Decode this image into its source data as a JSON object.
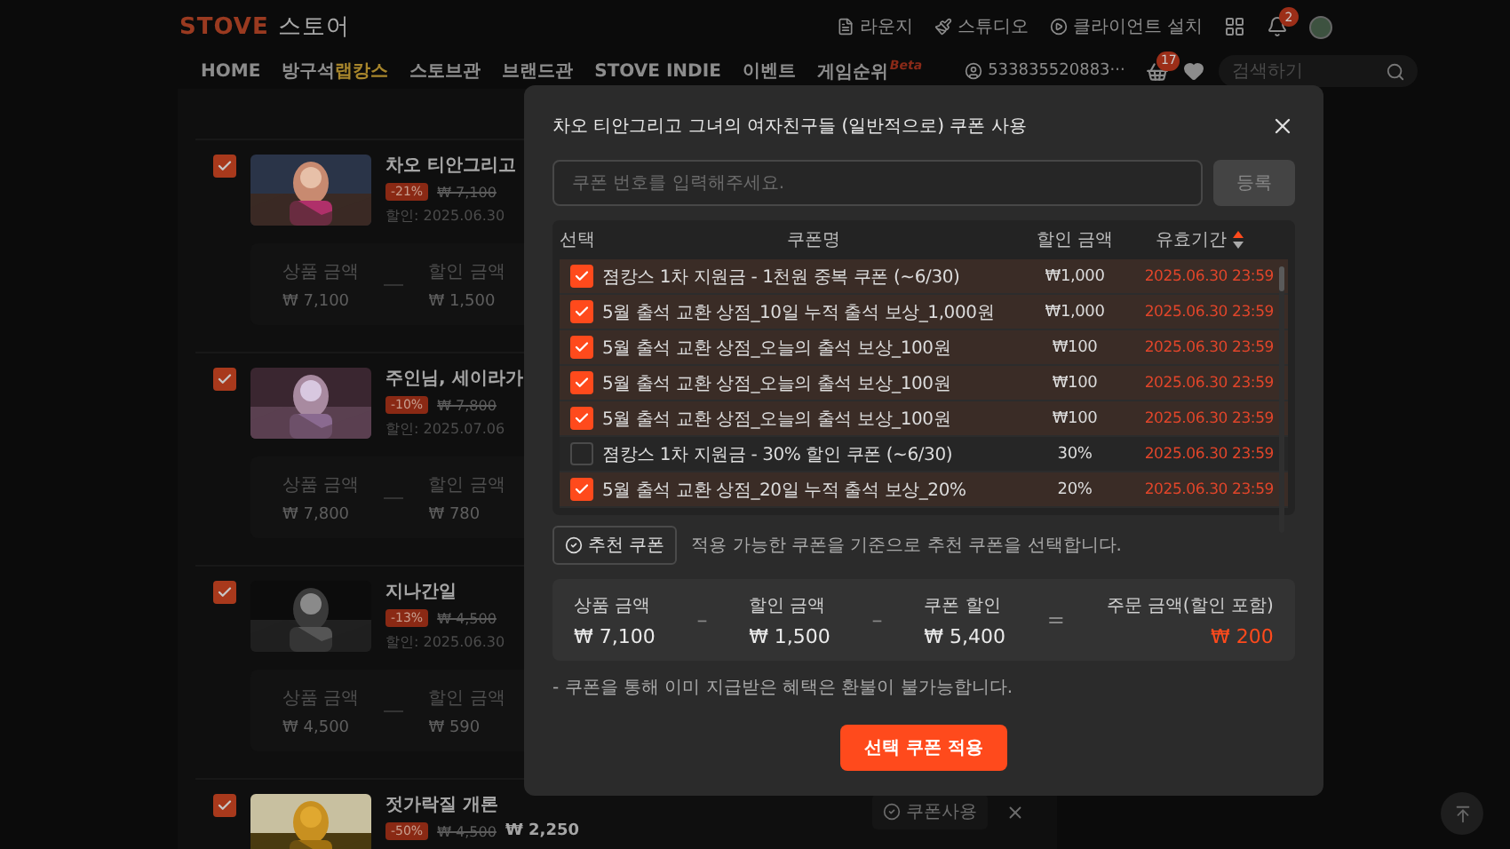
{
  "header": {
    "logo": {
      "brand": "STOVE",
      "store": "스토어"
    },
    "links": [
      {
        "kind": "lounge",
        "label": "라운지"
      },
      {
        "kind": "studio",
        "label": "스튜디오"
      },
      {
        "kind": "client",
        "label": "클라이언트 설치"
      }
    ],
    "notification_count": "2",
    "nav": [
      {
        "label": "HOME"
      },
      {
        "label": "방구석",
        "accent": "랩캉스"
      },
      {
        "label": "스토브관"
      },
      {
        "label": "브랜드관"
      },
      {
        "label": "STOVE INDIE"
      },
      {
        "label": "이벤트"
      },
      {
        "label": "게임순위",
        "tag": "Beta"
      }
    ],
    "user_id": "533835520883···",
    "cart_count": "17",
    "search": {
      "placeholder": "검색하기"
    }
  },
  "cart_items": [
    {
      "title": "차오 티안그리고",
      "checked": true,
      "discount": "-21%",
      "original_price": "₩ 7,100",
      "sale_date": "할인: 2025.06.30",
      "summary": [
        {
          "label": "상품 금액",
          "value": "₩ 7,100"
        },
        {
          "label": "할인 금액",
          "value": "₩ 1,500"
        }
      ]
    },
    {
      "title": "주인님, 세이라가",
      "checked": true,
      "discount": "-10%",
      "original_price": "₩ 7,800",
      "sale_date": "할인: 2025.07.06",
      "summary": [
        {
          "label": "상품 금액",
          "value": "₩ 7,800"
        },
        {
          "label": "할인 금액",
          "value": "₩ 780"
        }
      ]
    },
    {
      "title": "지나간일",
      "checked": true,
      "discount": "-13%",
      "original_price": "₩ 4,500",
      "sale_date": "할인: 2025.06.30",
      "summary": [
        {
          "label": "상품 금액",
          "value": "₩ 4,500"
        },
        {
          "label": "할인 금액",
          "value": "₩ 590"
        }
      ]
    },
    {
      "title": "젓가락질 개론",
      "checked": true,
      "discount": "-50%",
      "original_price": "₩ 4,500",
      "price": "₩ 2,250",
      "coupon_button": "쿠폰사용"
    }
  ],
  "modal": {
    "title": "차오 티안그리고 그녀의 여자친구들 (일반적으로) 쿠폰 사용",
    "coupon_input": {
      "placeholder": "쿠폰 번호를 입력해주세요."
    },
    "register_button": "등록",
    "columns": [
      "선택",
      "쿠폰명",
      "할인 금액",
      "유효기간"
    ],
    "coupons": [
      {
        "checked": true,
        "name": "졈캉스 1차 지원금 - 1천원 중복 쿠폰 (~6/30)",
        "amount": "₩1,000",
        "expiry": "2025.06.30 23:59"
      },
      {
        "checked": true,
        "name": "5월 출석 교환 상점_10일 누적 출석 보상_1,000원",
        "amount": "₩1,000",
        "expiry": "2025.06.30 23:59"
      },
      {
        "checked": true,
        "name": "5월 출석 교환 상점_오늘의 출석 보상_100원",
        "amount": "₩100",
        "expiry": "2025.06.30 23:59"
      },
      {
        "checked": true,
        "name": "5월 출석 교환 상점_오늘의 출석 보상_100원",
        "amount": "₩100",
        "expiry": "2025.06.30 23:59"
      },
      {
        "checked": true,
        "name": "5월 출석 교환 상점_오늘의 출석 보상_100원",
        "amount": "₩100",
        "expiry": "2025.06.30 23:59"
      },
      {
        "checked": false,
        "name": "졈캉스 1차 지원금 - 30% 할인 쿠폰 (~6/30)",
        "amount": "30%",
        "expiry": "2025.06.30 23:59"
      },
      {
        "checked": true,
        "name": "5월 출석 교환 상점_20일 누적 출석 보상_20%",
        "amount": "20%",
        "expiry": "2025.06.30 23:59"
      }
    ],
    "recommend_button": "추천 쿠폰",
    "recommend_text": "적용 가능한 쿠폰을 기준으로 추천 쿠폰을 선택합니다.",
    "summary": [
      {
        "kind": "value",
        "label": "상품 금액",
        "value": "₩ 7,100"
      },
      {
        "kind": "operator",
        "symbol": "–"
      },
      {
        "kind": "value",
        "label": "할인 금액",
        "value": "₩ 1,500"
      },
      {
        "kind": "operator",
        "symbol": "–"
      },
      {
        "kind": "value",
        "label": "쿠폰 할인",
        "value": "₩ 5,400"
      },
      {
        "kind": "operator",
        "symbol": "="
      },
      {
        "kind": "total",
        "label": "주문 금액(할인 포함)",
        "value": "₩ 200"
      }
    ],
    "note": "- 쿠폰을 통해 이미 지급받은 혜택은 환불이 불가능합니다.",
    "apply_button": "선택 쿠폰 적용"
  }
}
